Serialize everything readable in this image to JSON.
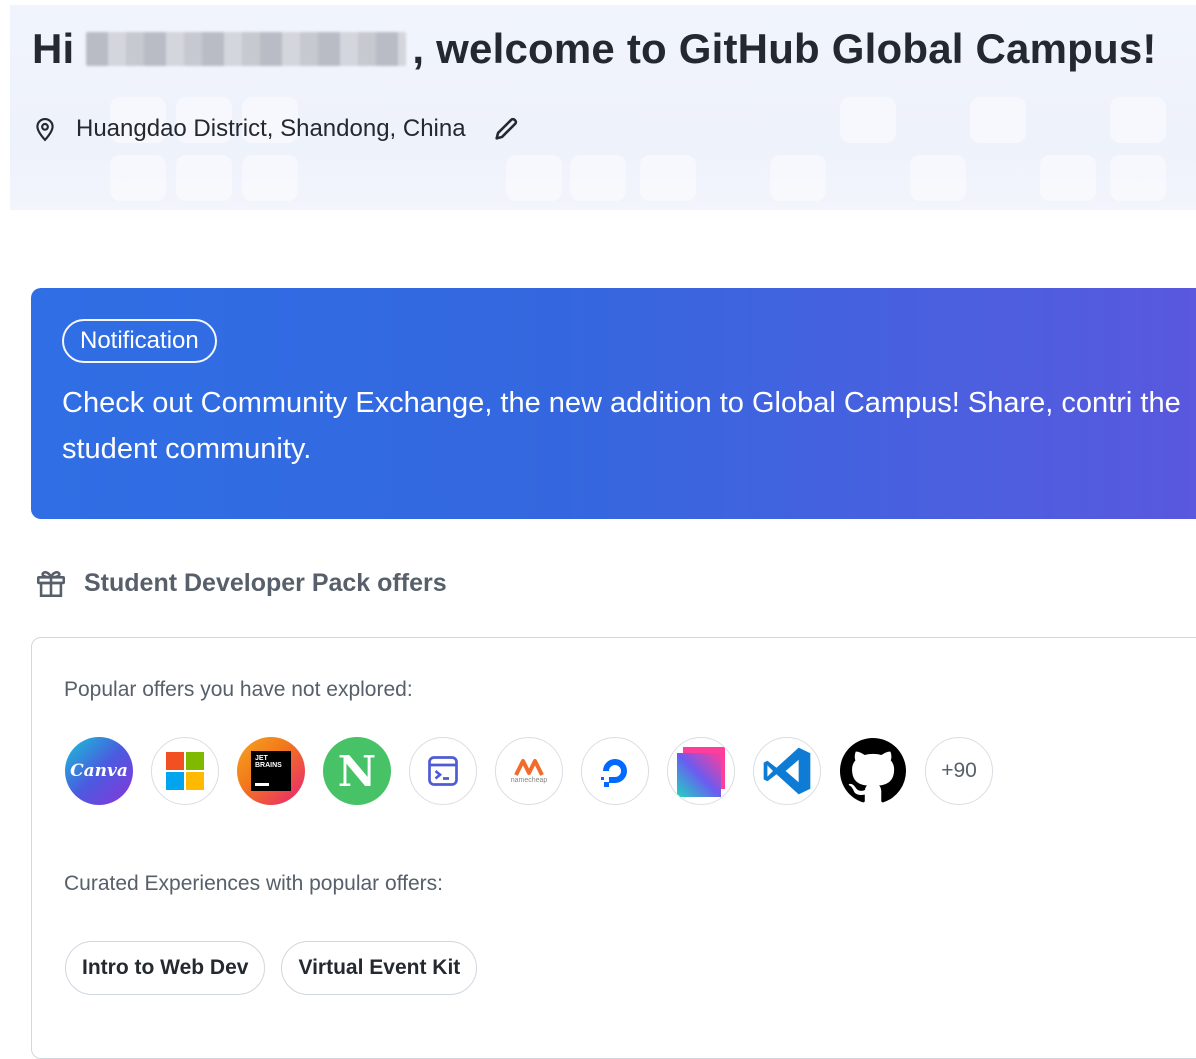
{
  "header": {
    "greeting_prefix": "Hi",
    "greeting_suffix": ", welcome to GitHub Global Campus!",
    "location": "Huangdao District, Shandong, China"
  },
  "notification": {
    "badge": "Notification",
    "message": "Check out Community Exchange, the new addition to Global Campus! Share, contri the student community."
  },
  "offers": {
    "section_title": "Student Developer Pack offers",
    "popular_label": "Popular offers you have not explored:",
    "more_count": "+90",
    "canva_text": "Canva",
    "jetbrains_text": "JET BRAINS",
    "notion_text": "N",
    "namecheap_text": "namecheap",
    "curated_label": "Curated Experiences with popular offers:",
    "chips": [
      "Intro to Web Dev",
      "Virtual Event Kit"
    ]
  }
}
